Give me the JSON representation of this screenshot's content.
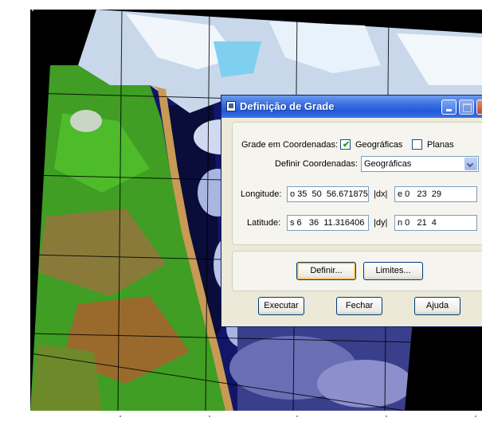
{
  "dialog": {
    "title": "Definição de Grade",
    "grid_coords_label": "Grade em Coordenadas:",
    "option_geographic": {
      "label": "Geográficas",
      "checked": true
    },
    "option_planar": {
      "label": "Planas",
      "checked": false
    },
    "define_coords_label": "Definir Coordenadas:",
    "define_coords_value": "Geográficas",
    "longitude_label": "Longitude:",
    "longitude_value": "o 35  50  56.671875",
    "dx_label": "|dx|",
    "dx_value": "e 0   23  29",
    "latitude_label": "Latitude:",
    "latitude_value": "s 6   36  11.316406",
    "dy_label": "|dy|",
    "dy_value": "n 0   21  4",
    "define_button": "Definir...",
    "limits_button": "Limites...",
    "execute_button": "Executar",
    "close_button": "Fechar",
    "help_button": "Ajuda"
  },
  "icons": {
    "window_icon": "app-window-icon",
    "minimize": "minimize-icon",
    "maximize": "maximize-icon",
    "close": "close-icon",
    "checkbox_check": "checkmark-icon",
    "dropdown": "chevron-down-icon"
  },
  "colors": {
    "titlebar": "#2358d8",
    "dialog_bg": "#ece9d8",
    "ocean": "#0c0f52",
    "vegetation": "#3f9e23",
    "clouds": "#d8e6ee"
  }
}
